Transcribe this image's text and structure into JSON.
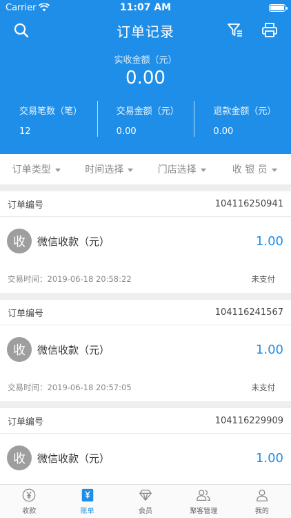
{
  "status": {
    "carrier": "Carrier",
    "time": "11:07 AM"
  },
  "nav": {
    "title": "订单记录",
    "icons": [
      "search-icon",
      "filter-icon",
      "printer-icon"
    ]
  },
  "summary": {
    "received_label": "实收金额（元）",
    "received_amount": "0.00",
    "stats": [
      {
        "label": "交易笔数（笔）",
        "value": "12"
      },
      {
        "label": "交易金额（元）",
        "value": "0.00"
      },
      {
        "label": "退款金额（元）",
        "value": "0.00"
      }
    ]
  },
  "filters": [
    "订单类型",
    "时间选择",
    "门店选择",
    "收 银 员"
  ],
  "orders": [
    {
      "no_label": "订单编号",
      "no": "104116250941",
      "avatar": "收",
      "type": "微信收款（元）",
      "amount": "1.00",
      "time": "交易时间：2019-06-18 20:58:22",
      "status": "未支付"
    },
    {
      "no_label": "订单编号",
      "no": "104116241567",
      "avatar": "收",
      "type": "微信收款（元）",
      "amount": "1.00",
      "time": "交易时间：2019-06-18 20:57:05",
      "status": "未支付"
    },
    {
      "no_label": "订单编号",
      "no": "104116229909",
      "avatar": "收",
      "type": "微信收款（元）",
      "amount": "1.00",
      "time": "",
      "status": ""
    }
  ],
  "tabs": [
    {
      "label": "收款",
      "icon": "yen-coin-icon",
      "active": false
    },
    {
      "label": "账单",
      "icon": "bill-icon",
      "active": true
    },
    {
      "label": "会员",
      "icon": "diamond-icon",
      "active": false
    },
    {
      "label": "聚客管理",
      "icon": "users-icon",
      "active": false
    },
    {
      "label": "我的",
      "icon": "person-icon",
      "active": false
    }
  ],
  "colors": {
    "primary": "#1f8ee8",
    "background": "#eeeeee",
    "avatar": "#9e9e9e"
  }
}
